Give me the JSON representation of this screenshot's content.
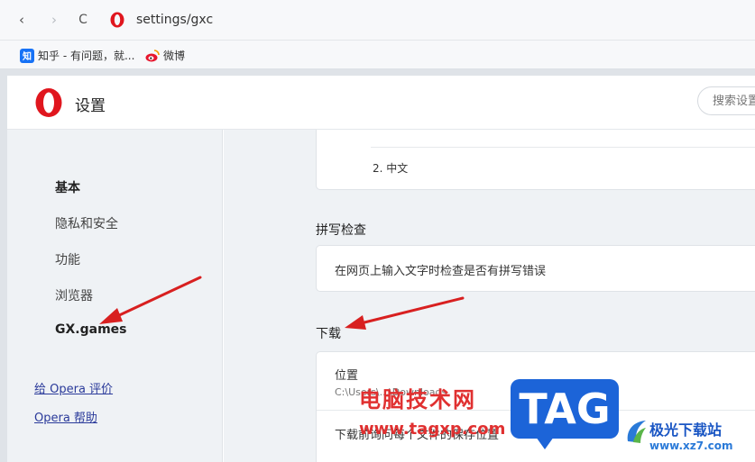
{
  "toolbar": {
    "back_glyph": "‹",
    "forward_glyph": "›",
    "reload_glyph": "C",
    "url": "settings/gxc"
  },
  "bookmarks": [
    {
      "label": "知乎 - 有问题，就...",
      "icon": "zhihu-icon",
      "icon_text": "知"
    },
    {
      "label": "微博",
      "icon": "weibo-icon"
    }
  ],
  "header": {
    "title": "设置",
    "search_placeholder": "搜索设置"
  },
  "sidebar": {
    "items": [
      {
        "label": "基本",
        "active": true
      },
      {
        "label": "隐私和安全"
      },
      {
        "label": "功能"
      },
      {
        "label": "浏览器"
      },
      {
        "label": "GX.games"
      }
    ],
    "links": [
      {
        "label": "给 Opera 评价"
      },
      {
        "label": "Opera 帮助"
      }
    ]
  },
  "content": {
    "language_item": "2. 中文",
    "spellcheck": {
      "title": "拼写检查",
      "option": "在网页上输入文字时检查是否有拼写错误"
    },
    "download": {
      "title": "下载",
      "location_label": "位置",
      "location_path": "C:\\Users\\...\\Downloads",
      "ask_label": "下载前询问每个文件的保存位置"
    }
  },
  "watermark": {
    "brand_text": "电脑技术网",
    "brand_url": "www.tagxp.com",
    "tag": "TAG",
    "site_name": "极光下载站",
    "site_url": "www.xz7.com"
  },
  "colors": {
    "accent_red": "#e03030",
    "opera_red": "#e0161e",
    "tag_blue": "#1c64d8"
  }
}
